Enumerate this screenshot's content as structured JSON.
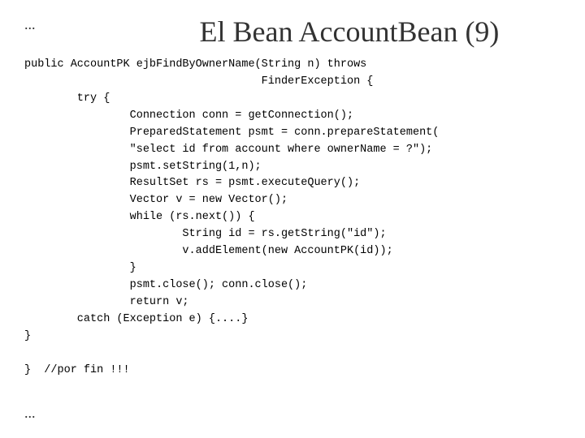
{
  "slide": {
    "title": "El Bean AccountBean (9)",
    "dots_top": "...",
    "dots_bottom": "...",
    "code": "public AccountPK ejbFindByOwnerName(String n) throws\n                                    FinderException {\n        try {\n                Connection conn = getConnection();\n                PreparedStatement psmt = conn.prepareStatement(\n                \"select id from account where ownerName = ?\");\n                psmt.setString(1,n);\n                ResultSet rs = psmt.executeQuery();\n                Vector v = new Vector();\n                while (rs.next()) {\n                        String id = rs.getString(\"id\");\n                        v.addElement(new AccountPK(id));\n                }\n                psmt.close(); conn.close();\n                return v;\n        catch (Exception e) {....}\n}\n\n}  //por fin !!!"
  }
}
